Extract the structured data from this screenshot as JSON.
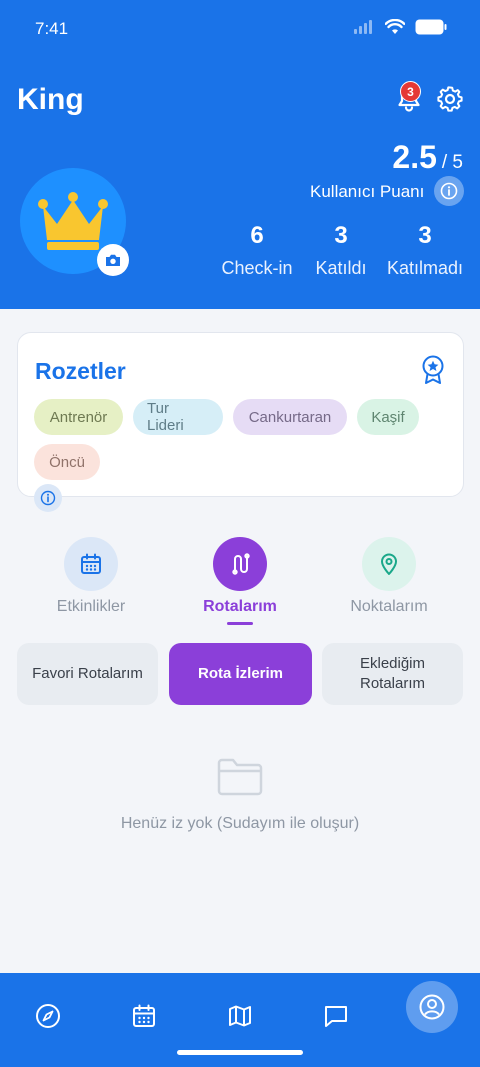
{
  "status": {
    "time": "7:41"
  },
  "profile": {
    "name": "King",
    "notification_count": "3",
    "score": "2.5",
    "score_max": "/ 5",
    "score_label": "Kullanıcı Puanı"
  },
  "stats": [
    {
      "value": "6",
      "label": "Check-in"
    },
    {
      "value": "3",
      "label": "Katıldı"
    },
    {
      "value": "3",
      "label": "Katılmadı"
    }
  ],
  "badges": {
    "title": "Rozetler",
    "items": [
      {
        "label": "Antrenör",
        "bg": "#e6f0c5",
        "fg": "#6f7a52"
      },
      {
        "label": "Tur Lideri",
        "bg": "#d6eef7",
        "fg": "#5f7d88"
      },
      {
        "label": "Cankurtaran",
        "bg": "#e6dcf5",
        "fg": "#766a88"
      },
      {
        "label": "Kaşif",
        "bg": "#d9f3e5",
        "fg": "#5f8570"
      },
      {
        "label": "Öncü",
        "bg": "#fbe3dc",
        "fg": "#90736a"
      }
    ]
  },
  "tabs": [
    {
      "label": "Etkinlikler",
      "icon": "calendar-icon",
      "active": false
    },
    {
      "label": "Rotalarım",
      "icon": "route-icon",
      "active": true
    },
    {
      "label": "Noktalarım",
      "icon": "map-pin-icon",
      "active": false
    }
  ],
  "subtabs": [
    {
      "label": "Favori Rotalarım",
      "active": false
    },
    {
      "label": "Rota İzlerim",
      "active": true
    },
    {
      "label": "Eklediğim Rotalarım",
      "active": false
    }
  ],
  "empty_state": {
    "text": "Henüz iz yok (Sudayım ile oluşur)"
  },
  "bottom_nav": [
    {
      "icon": "compass-icon"
    },
    {
      "icon": "calendar-icon"
    },
    {
      "icon": "map-icon"
    },
    {
      "icon": "chat-icon"
    },
    {
      "icon": "profile-icon",
      "active": true
    }
  ],
  "colors": {
    "primary": "#1a73e8",
    "accent_purple": "#8b3fd9",
    "teal": "#1aa88a",
    "crown": "#f9c62f"
  }
}
